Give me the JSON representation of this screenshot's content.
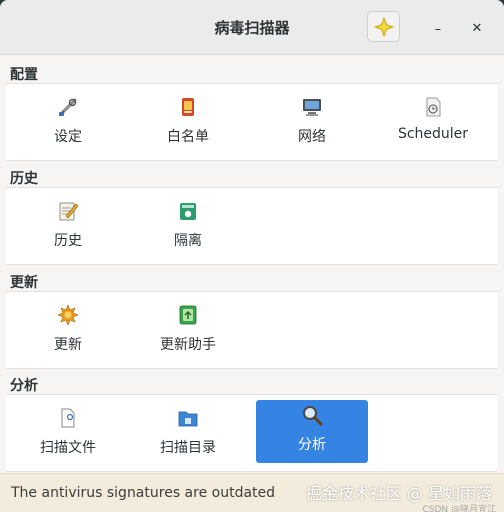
{
  "window": {
    "title": "病毒扫描器",
    "minimize_glyph": "⎯",
    "close_glyph": "✕"
  },
  "sections": [
    {
      "heading": "配置",
      "items": [
        {
          "label": "设定",
          "icon": "tools-icon"
        },
        {
          "label": "白名单",
          "icon": "whitelist-icon"
        },
        {
          "label": "网络",
          "icon": "network-icon"
        },
        {
          "label": "Scheduler",
          "icon": "scheduler-icon"
        }
      ]
    },
    {
      "heading": "历史",
      "items": [
        {
          "label": "历史",
          "icon": "history-icon"
        },
        {
          "label": "隔离",
          "icon": "quarantine-icon"
        }
      ]
    },
    {
      "heading": "更新",
      "items": [
        {
          "label": "更新",
          "icon": "update-icon"
        },
        {
          "label": "更新助手",
          "icon": "update-assistant-icon"
        }
      ]
    },
    {
      "heading": "分析",
      "items": [
        {
          "label": "扫描文件",
          "icon": "scan-file-icon"
        },
        {
          "label": "扫描目录",
          "icon": "scan-directory-icon"
        },
        {
          "label": "分析",
          "icon": "analysis-icon",
          "selected": true
        }
      ]
    }
  ],
  "status": {
    "message": "The antivirus signatures are outdated"
  },
  "watermark": {
    "main": "掘金技术社区 @ 星如雨落",
    "sub": "CSDN @晓月宜江"
  },
  "colors": {
    "selected": "#3584e4",
    "status_bg": "#f3ecdc"
  }
}
